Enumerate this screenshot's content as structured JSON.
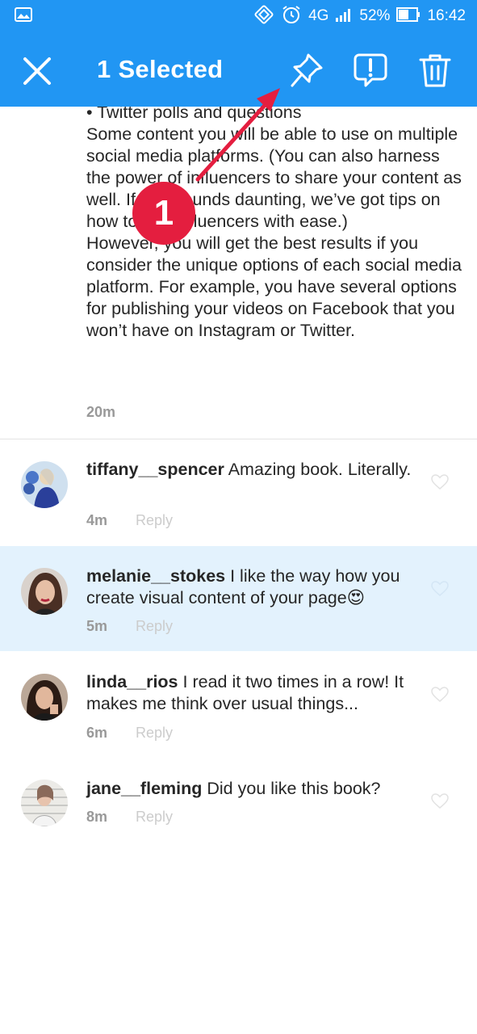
{
  "status_bar": {
    "network": "4G",
    "battery": "52%",
    "time": "16:42"
  },
  "action_bar": {
    "title": "1 Selected"
  },
  "caption": {
    "text": "• Twitter polls and questions\nSome content you will be able to use on multiple social media platforms. (You can also harness the power of influencers to share your content as well. If that sounds daunting, we’ve got tips on how to find influencers with ease.)\nHowever, you will get the best results if you consider the unique options of each social media platform. For example, you have several options for publishing your videos on Facebook that you won’t have on Instagram or Twitter.",
    "time": "20m"
  },
  "comments": [
    {
      "username": "tiffany__spencer",
      "text": "Amazing book. Literally.",
      "time": "4m",
      "reply": "Reply"
    },
    {
      "username": "melanie__stokes",
      "text": "I like the way how you create visual content of your page😍",
      "time": "5m",
      "reply": "Reply"
    },
    {
      "username": "linda__rios",
      "text": "I read it two times in a row! It makes me think over usual things...",
      "time": "6m",
      "reply": "Reply"
    },
    {
      "username": "jane__fleming",
      "text": "Did you like this book?",
      "time": "8m",
      "reply": "Reply"
    }
  ],
  "annotation": {
    "step_number": "1",
    "color": "#e41e3f"
  },
  "colors": {
    "accent": "#2196f3",
    "selected_row": "#e3f2fd"
  },
  "icons": [
    "gallery-icon",
    "nfc-icon",
    "alarm-icon",
    "signal-icon",
    "battery-icon",
    "close-icon",
    "pin-icon",
    "report-icon",
    "trash-icon",
    "heart-icon"
  ]
}
